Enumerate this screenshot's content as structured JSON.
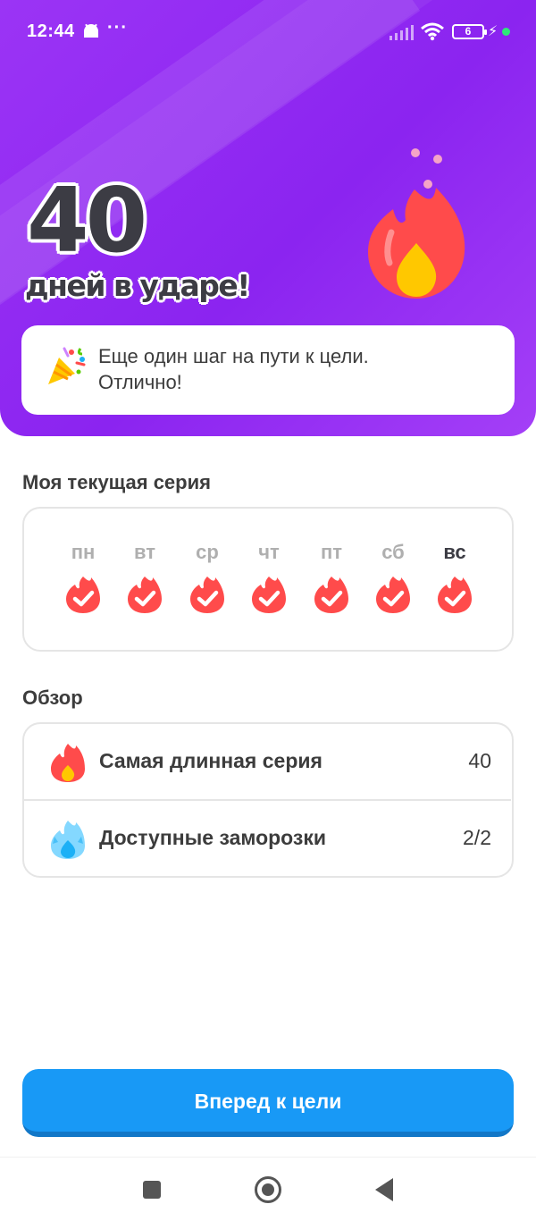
{
  "status_bar": {
    "time": "12:44",
    "dots": "···",
    "battery": "6",
    "bolt": "⚡"
  },
  "hero": {
    "streak_number": "40",
    "streak_caption": "дней в ударе!",
    "message_line1": "Еще один шаг на пути к цели.",
    "message_line2": "Отлично!"
  },
  "week": {
    "title": "Моя текущая серия",
    "days": [
      "пн",
      "вт",
      "ср",
      "чт",
      "пт",
      "сб",
      "вс"
    ],
    "completed": [
      true,
      true,
      true,
      true,
      true,
      true,
      true
    ],
    "today_index": 6
  },
  "overview": {
    "title": "Обзор",
    "rows": [
      {
        "label": "Самая длинная серия",
        "value": "40",
        "icon": "fire-icon"
      },
      {
        "label": "Доступные заморозки",
        "value": "2/2",
        "icon": "freeze-icon"
      }
    ]
  },
  "cta": {
    "label": "Вперед к цели"
  },
  "colors": {
    "hero_bg": "#9b34f5",
    "fire_red": "#ff4b4b",
    "fire_yellow": "#ffc800",
    "button_blue": "#1899f6",
    "freeze_blue": "#49c0f8"
  }
}
